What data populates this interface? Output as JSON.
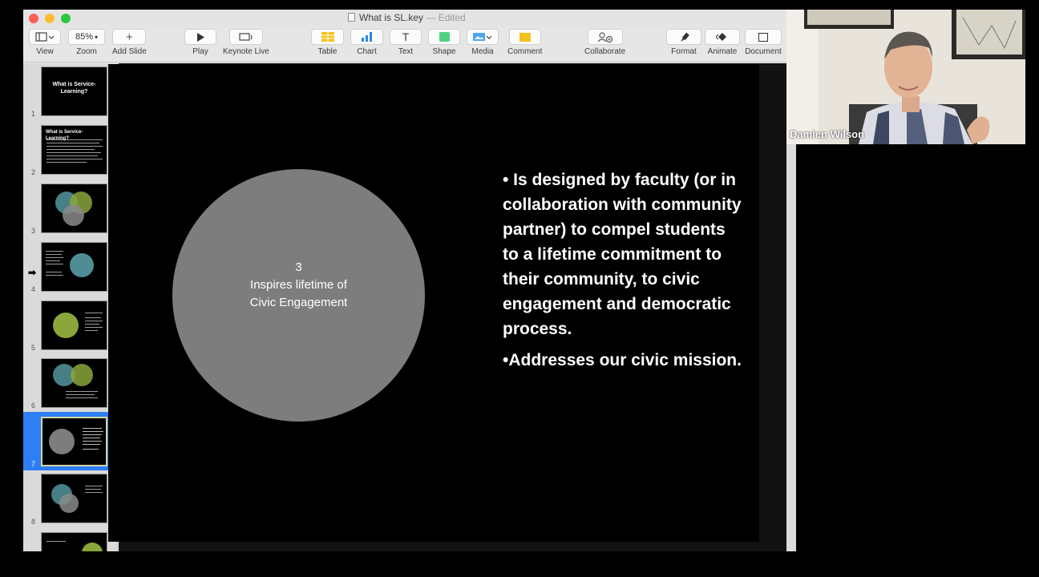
{
  "window": {
    "title": "What is SL.key",
    "title_sep": " — ",
    "status": "Edited"
  },
  "toolbar": {
    "view": "View",
    "zoom_value": "85%",
    "zoom": "Zoom",
    "add_slide": "Add Slide",
    "play": "Play",
    "keynote_live": "Keynote Live",
    "table": "Table",
    "chart": "Chart",
    "text": "Text",
    "text_glyph": "T",
    "shape": "Shape",
    "media": "Media",
    "comment": "Comment",
    "collaborate": "Collaborate",
    "format": "Format",
    "animate": "Animate",
    "document": "Document"
  },
  "navigator": {
    "slide_numbers": [
      "1",
      "2",
      "3",
      "4",
      "5",
      "6",
      "7",
      "8"
    ],
    "selected": 7,
    "thumb_titles": {
      "s1": "What is Service-Learning?",
      "s2": "What is Service-Learning?"
    }
  },
  "slide": {
    "circle_number": "3",
    "circle_line1": "Inspires lifetime of",
    "circle_line2": "Civic Engagement",
    "bullet1": "• Is designed by faculty (or in collaboration with community partner) to compel students to a lifetime commitment to their community, to civic engagement and democratic process.",
    "bullet2": "•Addresses our civic mission."
  },
  "video": {
    "participant_name": "Damien Wilson"
  },
  "colors": {
    "selection": "#2e7ef6",
    "circle": "#7d7d7d",
    "thumb_green": "#8aa63a",
    "thumb_teal": "#4e8d93"
  }
}
